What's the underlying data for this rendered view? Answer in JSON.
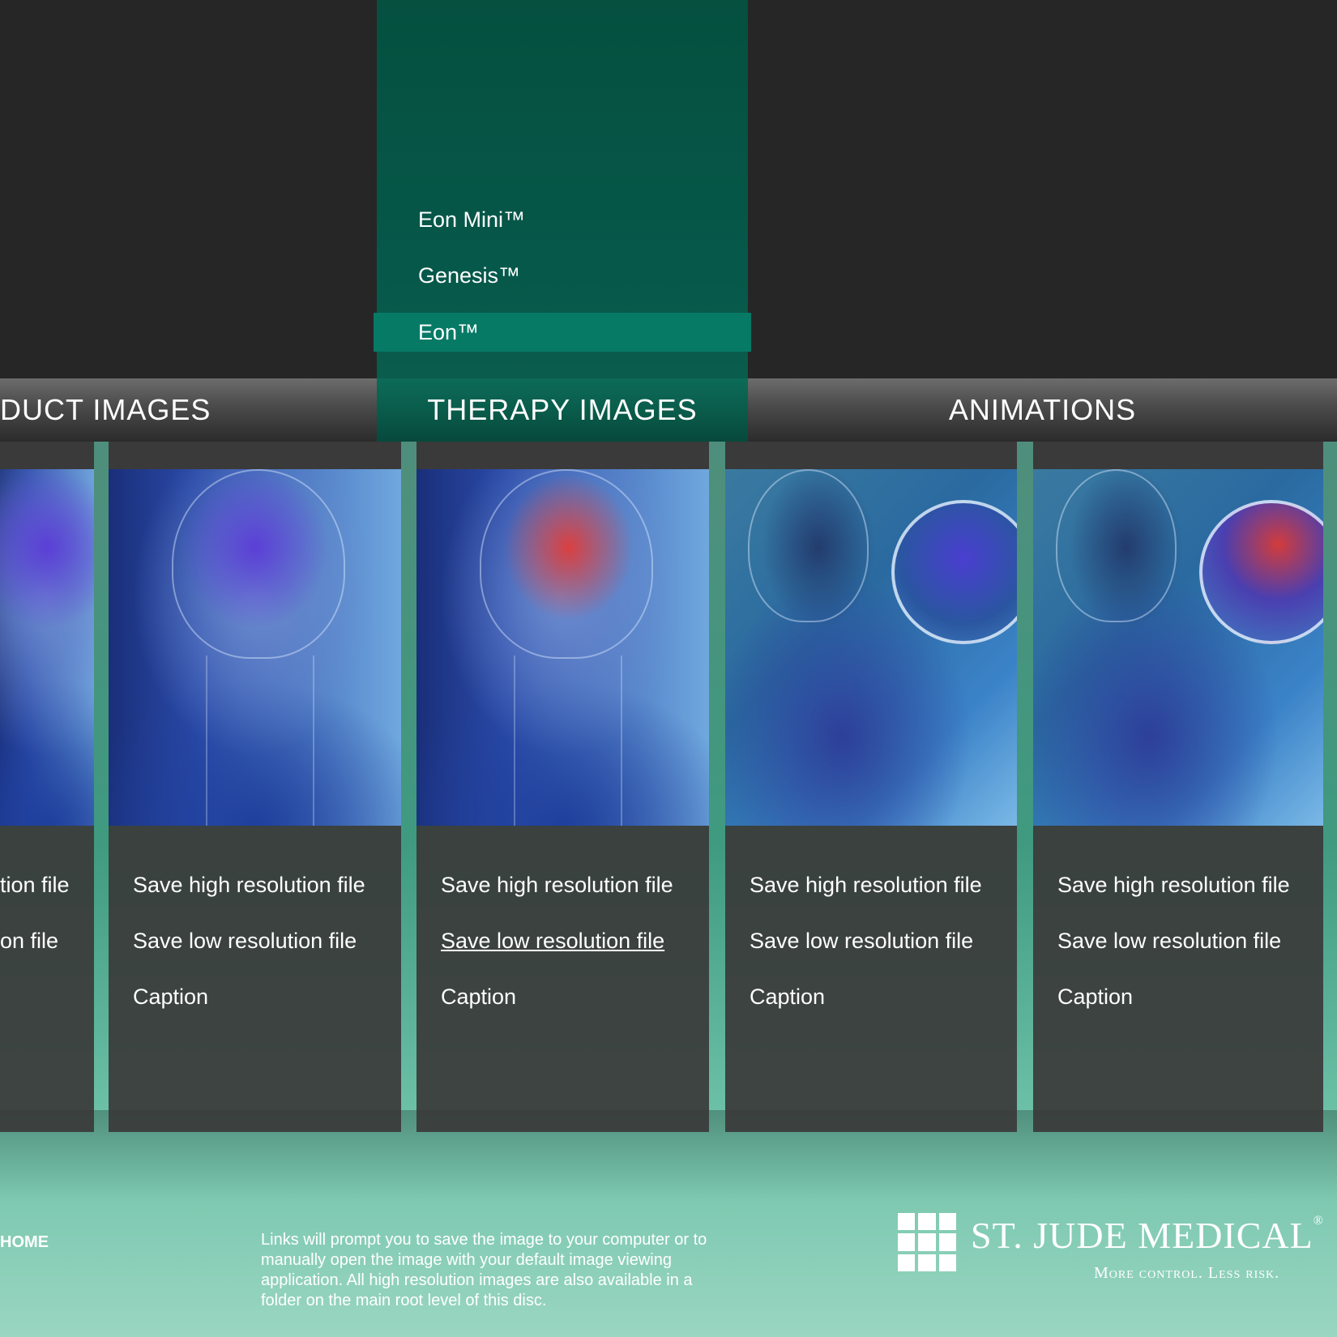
{
  "menu": {
    "items": [
      {
        "label": "Eon Mini™"
      },
      {
        "label": "Genesis™"
      },
      {
        "label": "Eon™"
      }
    ]
  },
  "tabs": [
    {
      "label": "DUCT IMAGES"
    },
    {
      "label": "THERAPY IMAGES"
    },
    {
      "label": "ANIMATIONS"
    }
  ],
  "cards": [
    {
      "high_label": "tion file",
      "low_label": "on file",
      "caption_label": ""
    },
    {
      "high_label": "Save high resolution file",
      "low_label": "Save low resolution file",
      "caption_label": "Caption"
    },
    {
      "high_label": "Save high resolution file",
      "low_label": "Save low resolution file",
      "caption_label": "Caption"
    },
    {
      "high_label": "Save high resolution file",
      "low_label": "Save low resolution file",
      "caption_label": "Caption"
    },
    {
      "high_label": "Save high resolution file",
      "low_label": "Save low resolution file",
      "caption_label": "Caption"
    }
  ],
  "footer": {
    "home_label": "HOME",
    "note": "Links will prompt you to save the image to your computer or to manually open the image with your default image viewing application. All high resolution images are also available in a folder on the main root level of this disc.",
    "logo_name": "ST. JUDE MEDICAL",
    "logo_trademark": "®",
    "logo_tagline": "More control. Less risk."
  },
  "colors": {
    "active_menu": "#077a66",
    "panel": "#05503f",
    "background": "#262626"
  }
}
